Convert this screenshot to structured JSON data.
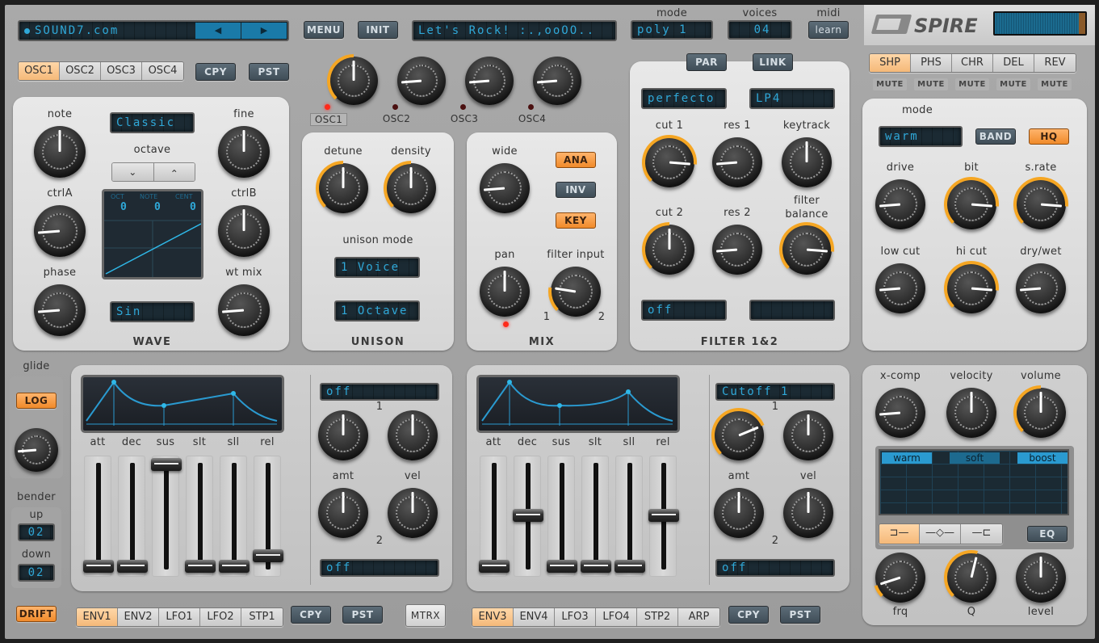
{
  "header": {
    "preset_bank": "SOUND7.com",
    "prev_icon": "◀",
    "next_icon": "▶",
    "menu_label": "MENU",
    "init_label": "INIT",
    "preset_name": "Let's Rock! :.,ooOO..",
    "mode_label": "mode",
    "mode_value": "poly 1",
    "voices_label": "voices",
    "voices_value": "04",
    "midi_label": "midi",
    "midi_learn_label": "learn",
    "logo_text": "SPIRE"
  },
  "osc_tabs": {
    "items": [
      "OSC1",
      "OSC2",
      "OSC3",
      "OSC4"
    ],
    "active": 0,
    "copy_label": "CPY",
    "paste_label": "PST"
  },
  "osc_mix": {
    "knobs": [
      {
        "label": "OSC1",
        "value": 0.5,
        "active": true
      },
      {
        "label": "OSC2",
        "value": 0.15,
        "active": false
      },
      {
        "label": "OSC3",
        "value": 0.15,
        "active": false
      },
      {
        "label": "OSC4",
        "value": 0.15,
        "active": false
      }
    ]
  },
  "wave": {
    "section_title": "WAVE",
    "mode_value": "Classic",
    "octave_label": "octave",
    "down_icon": "⌄",
    "up_icon": "⌃",
    "display": {
      "oct_label": "OCT",
      "note_label": "NOTE",
      "cent_label": "CENT",
      "oct": "0",
      "note": "0",
      "cent": "0"
    },
    "wave_value": "Sin",
    "knobs": [
      {
        "label": "note",
        "value": 0.5
      },
      {
        "label": "fine",
        "value": 0.5
      },
      {
        "label": "ctrlA",
        "value": 0.15
      },
      {
        "label": "ctrlB",
        "value": 0.5
      },
      {
        "label": "phase",
        "value": 0.15
      },
      {
        "label": "wt mix",
        "value": 0.15
      }
    ]
  },
  "unison": {
    "section_title": "UNISON",
    "detune_label": "detune",
    "detune_value": 0.5,
    "density_label": "density",
    "density_value": 0.5,
    "mode_label": "unison mode",
    "voice_value": "1 Voice",
    "octave_value": "1 Octave"
  },
  "mix": {
    "section_title": "MIX",
    "wide_label": "wide",
    "wide_value": 0.15,
    "ana_label": "ANA",
    "inv_label": "INV",
    "key_label": "KEY",
    "pan_label": "pan",
    "pan_value": 0.5,
    "filter_input_label": "filter input",
    "filter_input_value": 0.2,
    "fi_min": "1",
    "fi_max": "2"
  },
  "filter": {
    "section_title": "FILTER 1&2",
    "par_label": "PAR",
    "link_label": "LINK",
    "type1": "perfecto",
    "type2": "LP4",
    "knobs": [
      {
        "label": "cut 1",
        "value": 0.85,
        "arc": true
      },
      {
        "label": "res 1",
        "value": 0.15,
        "arc": false
      },
      {
        "label": "keytrack",
        "value": 0.5,
        "arc": false
      },
      {
        "label": "cut 2",
        "value": 0.5,
        "arc": true
      },
      {
        "label": "res 2",
        "value": 0.15,
        "arc": false
      },
      {
        "label": "filter balance",
        "value": 0.85,
        "arc": true
      }
    ],
    "mode1": "off",
    "mode2": ""
  },
  "fx": {
    "tabs": [
      "SHP",
      "PHS",
      "CHR",
      "DEL",
      "REV"
    ],
    "active": 0,
    "mute_label": "MUTE",
    "mode_label": "mode",
    "mode_value": "warm",
    "band_label": "BAND",
    "hq_label": "HQ",
    "knobs": [
      {
        "label": "drive",
        "value": 0.15,
        "arc": false
      },
      {
        "label": "bit",
        "value": 0.85,
        "arc": true
      },
      {
        "label": "s.rate",
        "value": 0.85,
        "arc": true
      },
      {
        "label": "low cut",
        "value": 0.15,
        "arc": false
      },
      {
        "label": "hi cut",
        "value": 0.85,
        "arc": true
      },
      {
        "label": "dry/wet",
        "value": 0.15,
        "arc": false
      }
    ]
  },
  "glide": {
    "label": "glide",
    "log_label": "LOG",
    "value": 0.15,
    "bender_label": "bender",
    "up_label": "up",
    "up_value": "02",
    "down_label": "down",
    "down_value": "02",
    "drift_label": "DRIFT"
  },
  "env1": {
    "slider_labels": [
      "att",
      "dec",
      "sus",
      "slt",
      "sll",
      "rel"
    ],
    "slider_values": [
      0.0,
      0.0,
      1.0,
      0.0,
      0.0,
      0.1
    ],
    "tabs": [
      "ENV1",
      "ENV2",
      "LFO1",
      "LFO2",
      "STP1"
    ],
    "active": 0,
    "copy_label": "CPY",
    "paste_label": "PST",
    "mod1_target": "off",
    "mod2_target": "off",
    "amt_label": "amt",
    "vel_label": "vel",
    "slot1": "1",
    "slot2": "2",
    "amt1": 0.5,
    "vel1": 0.5,
    "amt2": 0.5,
    "vel2": 0.5
  },
  "matrix_label": "MTRX",
  "env2": {
    "slider_labels": [
      "att",
      "dec",
      "sus",
      "slt",
      "sll",
      "rel"
    ],
    "slider_values": [
      0.0,
      0.5,
      0.0,
      0.0,
      0.0,
      0.5
    ],
    "tabs": [
      "ENV3",
      "ENV4",
      "LFO3",
      "LFO4",
      "STP2",
      "ARP"
    ],
    "active": 0,
    "copy_label": "CPY",
    "paste_label": "PST",
    "mod1_target": "Cutoff 1",
    "mod2_target": "off",
    "amt_label": "amt",
    "vel_label": "vel",
    "slot1": "1",
    "slot2": "2",
    "amt1": 0.75,
    "vel1": 0.5,
    "amt2": 0.5,
    "vel2": 0.5
  },
  "master": {
    "knobs": [
      {
        "label": "x-comp",
        "value": 0.15,
        "arc": false
      },
      {
        "label": "velocity",
        "value": 0.5,
        "arc": false
      },
      {
        "label": "volume",
        "value": 0.5,
        "arc": true
      }
    ],
    "eq_modes": [
      "warm",
      "soft",
      "boost"
    ],
    "eq_shapes": [
      "low-shelf-icon",
      "peak-icon",
      "high-shelf-icon"
    ],
    "eq_shape_active": 0,
    "eq_label": "EQ",
    "bottom_knobs": [
      {
        "label": "frq",
        "value": 0.1,
        "arc": true
      },
      {
        "label": "Q",
        "value": 0.55,
        "arc": true
      },
      {
        "label": "level",
        "value": 0.5,
        "arc": false
      }
    ]
  },
  "colors": {
    "accent": "#f5a623",
    "lcd_text": "#2fa8d8",
    "lcd_bg": "#1b2a33"
  }
}
